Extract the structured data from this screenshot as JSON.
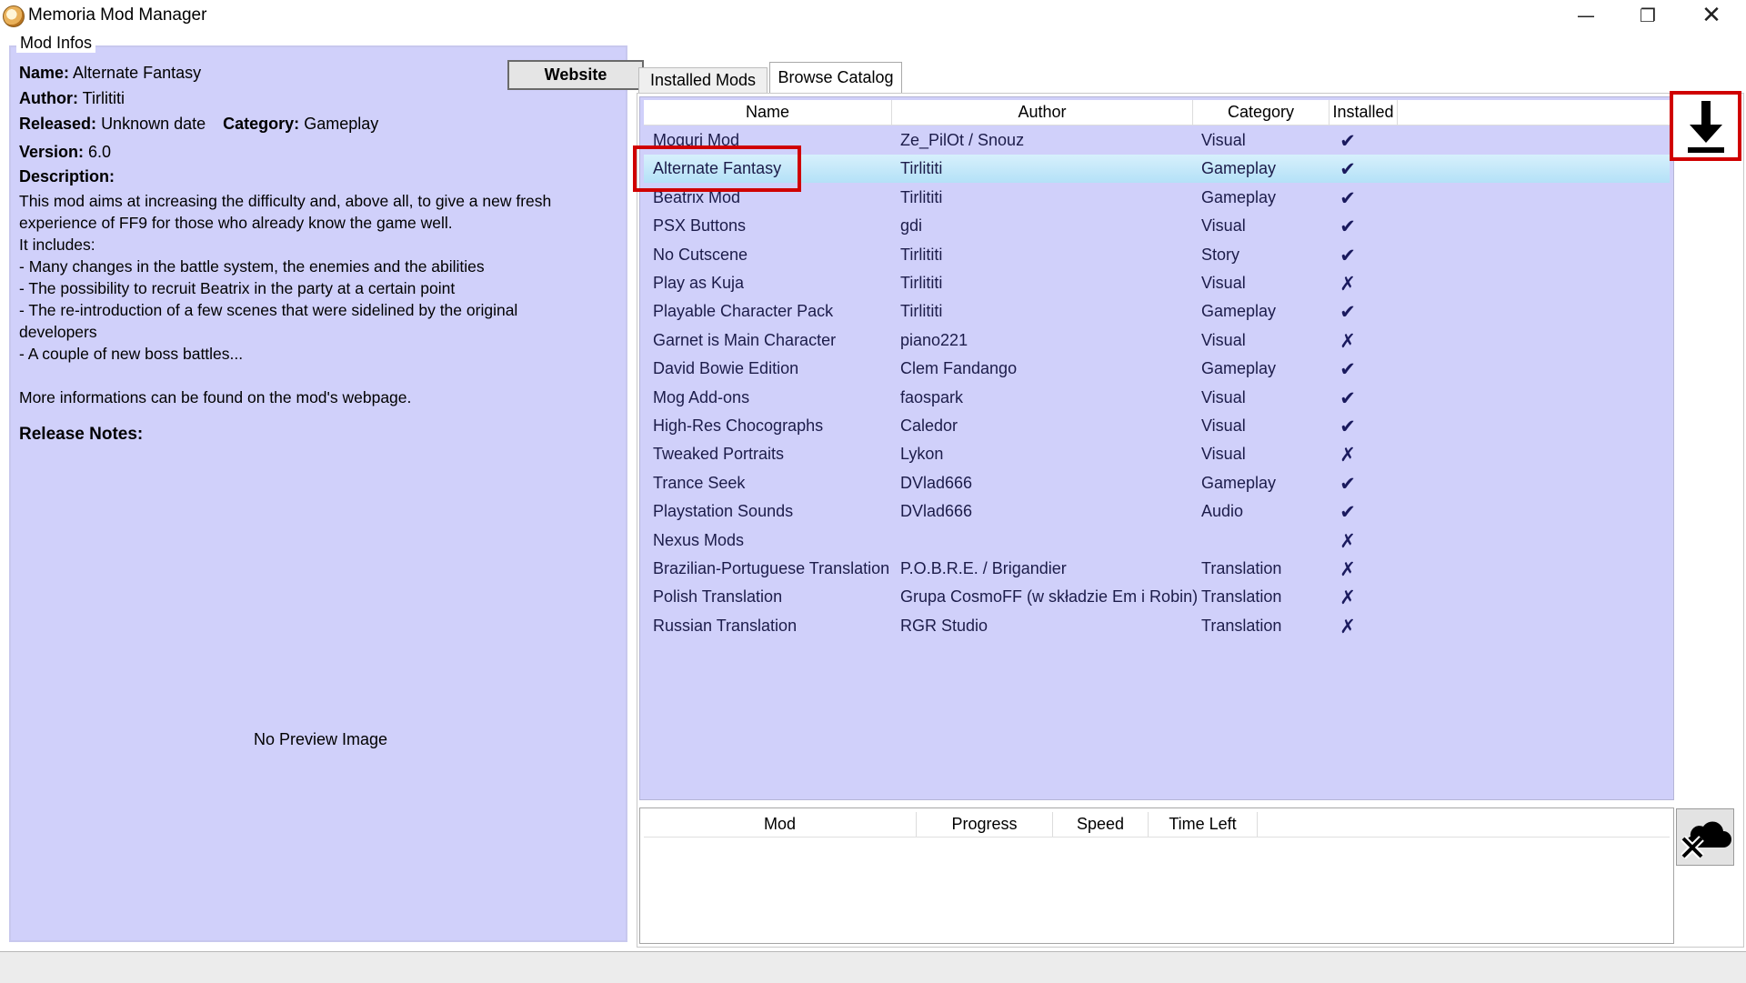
{
  "window": {
    "title": "Memoria Mod Manager",
    "controls": [
      "minimize-icon",
      "restore-icon",
      "close-icon"
    ]
  },
  "mod_info": {
    "group_title": "Mod Infos",
    "name_label": "Name:",
    "name_value": "Alternate Fantasy",
    "author_label": "Author:",
    "author_value": "Tirlititi",
    "released_label": "Released:",
    "released_value": "Unknown date",
    "category_label": "Category:",
    "category_value": "Gameplay",
    "version_label": "Version:",
    "version_value": "6.0",
    "description_label": "Description:",
    "description_text": "This mod aims at increasing the difficulty and, above all, to give a new fresh\nexperience of FF9 for those who already know the game well.\nIt includes:\n- Many changes in the battle system, the enemies and the abilities\n- The possibility to recruit Beatrix in the party at a certain point\n- The re-introduction of a few scenes that were sidelined by the original\ndevelopers\n- A couple of new boss battles...\n\nMore informations can be found on the mod's webpage.",
    "release_notes_label": "Release Notes:",
    "website_button": "Website",
    "no_preview": "No Preview Image"
  },
  "tabs": [
    {
      "label": "Installed Mods",
      "active": false
    },
    {
      "label": "Browse Catalog",
      "active": true
    }
  ],
  "catalog": {
    "columns": [
      "Name",
      "Author",
      "Category",
      "Installed"
    ],
    "rows": [
      {
        "name": "Moguri Mod",
        "author": "Ze_PilOt / Snouz",
        "category": "Visual",
        "installed": "✔"
      },
      {
        "name": "Alternate Fantasy",
        "author": "Tirlititi",
        "category": "Gameplay",
        "installed": "✔",
        "selected": true
      },
      {
        "name": "Beatrix Mod",
        "author": "Tirlititi",
        "category": "Gameplay",
        "installed": "✔"
      },
      {
        "name": "PSX Buttons",
        "author": "gdi",
        "category": "Visual",
        "installed": "✔"
      },
      {
        "name": "No Cutscene",
        "author": "Tirlititi",
        "category": "Story",
        "installed": "✔"
      },
      {
        "name": "Play as Kuja",
        "author": "Tirlititi",
        "category": "Visual",
        "installed": "✗"
      },
      {
        "name": "Playable Character Pack",
        "author": "Tirlititi",
        "category": "Gameplay",
        "installed": "✔"
      },
      {
        "name": "Garnet is Main Character",
        "author": "piano221",
        "category": "Visual",
        "installed": "✗"
      },
      {
        "name": "David Bowie Edition",
        "author": "Clem Fandango",
        "category": "Gameplay",
        "installed": "✔"
      },
      {
        "name": "Mog Add-ons",
        "author": "faospark",
        "category": "Visual",
        "installed": "✔"
      },
      {
        "name": "High-Res Chocographs",
        "author": "Caledor",
        "category": "Visual",
        "installed": "✔"
      },
      {
        "name": "Tweaked Portraits",
        "author": "Lykon",
        "category": "Visual",
        "installed": "✗"
      },
      {
        "name": "Trance Seek",
        "author": "DVlad666",
        "category": "Gameplay",
        "installed": "✔"
      },
      {
        "name": "Playstation Sounds",
        "author": "DVlad666",
        "category": "Audio",
        "installed": "✔"
      },
      {
        "name": "Nexus Mods",
        "author": "",
        "category": "",
        "installed": "✗"
      },
      {
        "name": "Brazilian-Portuguese Translation",
        "author": "P.O.B.R.E. / Brigandier",
        "category": "Translation",
        "installed": "✗"
      },
      {
        "name": "Polish Translation",
        "author": "Grupa CosmoFF (w składzie Em i Robin)",
        "category": "Translation",
        "installed": "✗"
      },
      {
        "name": "Russian Translation",
        "author": "RGR Studio",
        "category": "Translation",
        "installed": "✗"
      }
    ]
  },
  "download_button_icon": "download-arrow-icon",
  "queue": {
    "columns": [
      "Mod",
      "Progress",
      "Speed",
      "Time Left"
    ]
  },
  "cancel_button_icon": "cancel-download-cloud-icon",
  "colors": {
    "panel_bg": "#d0d0fa",
    "selected_row": "#b4e1f7",
    "highlight": "#d00000"
  }
}
